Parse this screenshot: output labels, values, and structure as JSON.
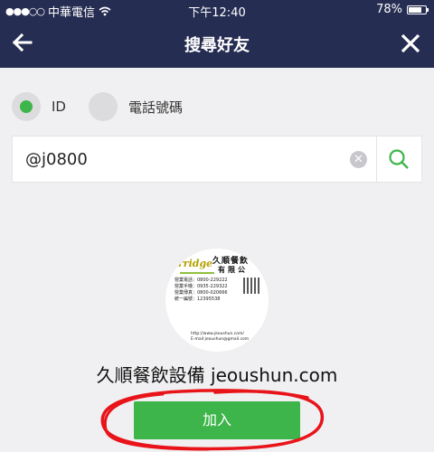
{
  "status_bar": {
    "carrier": "中華電信",
    "time": "下午12:40",
    "battery": "78%",
    "battery_level": 0.78,
    "signal_icon": "signal-dots-icon",
    "wifi_icon": "wifi-icon"
  },
  "nav": {
    "title": "搜尋好友",
    "back_icon": "back-arrow-icon",
    "close_icon": "close-icon",
    "bg_color": "#262d52"
  },
  "search_type": {
    "options": [
      {
        "label": "ID",
        "selected": true
      },
      {
        "label": "電話號碼",
        "selected": false
      }
    ],
    "accent_color": "#3db54a"
  },
  "search": {
    "value": "@j0800",
    "clear_icon": "clear-icon",
    "search_icon": "search-icon"
  },
  "result": {
    "name": "久順餐飲設備 jeoushun.com",
    "avatar_card": {
      "logo_text": "rridge",
      "name_line1": "久順餐飲",
      "name_line2": "有限公",
      "phone_lines": [
        "營業電話：0800-229222",
        "營業手機：0935-229322",
        "營業傳真：0800-020666",
        "統一編號：12395538"
      ],
      "website": "http://www.jeoushun.com/",
      "email": "E-mail:jeoushun@gmail.com"
    },
    "add_button_label": "加入",
    "add_button_color": "#3db54a"
  }
}
